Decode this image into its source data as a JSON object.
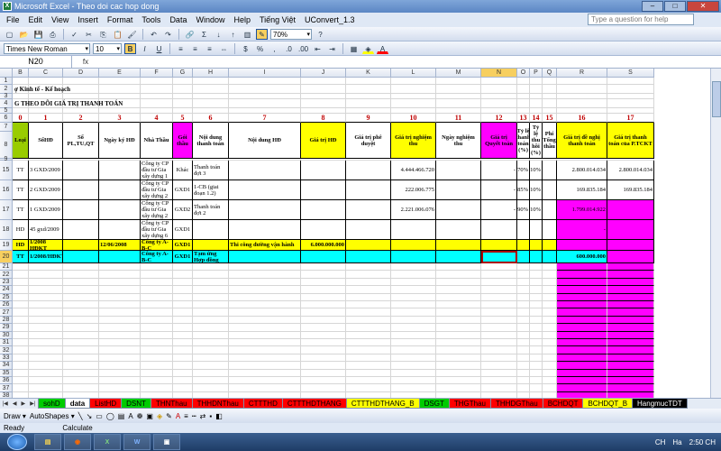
{
  "window": {
    "title": "Microsoft Excel - Theo doi cac hop dong"
  },
  "menu": [
    "File",
    "Edit",
    "View",
    "Insert",
    "Format",
    "Tools",
    "Data",
    "Window",
    "Help",
    "Tiếng Việt",
    "UConvert_1.3"
  ],
  "help_placeholder": "Type a question for help",
  "toolbar": {
    "zoom": "70%",
    "font": "Times New Roman",
    "size": "10"
  },
  "namebox": "N20",
  "columns": [
    "A",
    "B",
    "C",
    "D",
    "E",
    "F",
    "G",
    "H",
    "I",
    "J",
    "K",
    "L",
    "M",
    "N",
    "O",
    "P",
    "Q",
    "R",
    "S"
  ],
  "selected_col": "N",
  "rows": [
    "1",
    "2",
    "3",
    "4",
    "5",
    "6",
    "7",
    "8",
    "9",
    "15",
    "16",
    "17",
    "18",
    "19",
    "20",
    "21",
    "22",
    "23",
    "24",
    "25",
    "26",
    "27",
    "28",
    "29",
    "30",
    "31",
    "32",
    "33",
    "34",
    "35",
    "36",
    "37",
    "38",
    "39"
  ],
  "selected_row": "20",
  "title_text": {
    "r2": "ợ Kinh tế - Kế hoạch",
    "r4": "G THEO DÕI GIÁ TRỊ THANH TOÁN"
  },
  "colnums": [
    "0",
    "1",
    "2",
    "3",
    "4",
    "5",
    "6",
    "7",
    "8",
    "9",
    "10",
    "11",
    "12",
    "13",
    "14",
    "15",
    "16",
    "17"
  ],
  "headers": [
    "Loại",
    "SốHĐ",
    "Số PL,TU,QT",
    "Ngày ký HĐ",
    "Nhà Thầu",
    "Gói thầu",
    "Nội dung thanh toán",
    "Nội dung HĐ",
    "Giá trị HĐ",
    "Giá trị phê duyệt",
    "Giá trị nghiệm thu",
    "Ngày nghiệm thu",
    "Giá trị Quyết toán",
    "Tỷ lệ thanh toán (%)",
    "Tỷ lệ thu hồi (%)",
    "Phí Tổng thầu",
    "Giá trị đề nghị thanh toán",
    "Giá trị thanh toán của P.TCKT"
  ],
  "data_rows": [
    {
      "row": "15",
      "cells": [
        "TT",
        "3 GXD/2009",
        "",
        "",
        "Công ty CP đầu tư Gia xây dựng 1",
        "Khác",
        "Thanh toán đợt 3",
        "",
        "",
        "",
        "4.444.466.720",
        "",
        "-",
        "70%",
        "10%",
        "",
        "2.800.014.034",
        "2.800.014.034"
      ]
    },
    {
      "row": "16",
      "cells": [
        "TT",
        "2 GXD/2009",
        "",
        "",
        "Công ty CP đầu tư Gia xây dựng 2",
        "GXD1",
        "1-CB (giai đoạn 1.2)",
        "",
        "",
        "",
        "222.006.775",
        "",
        "-",
        "85%",
        "10%",
        "",
        "169.835.184",
        "169.835.184"
      ]
    },
    {
      "row": "17",
      "cells": [
        "TT",
        "1 GXD/2009",
        "",
        "",
        "Công ty CP đầu tư Gia xây dựng 2",
        "GXD2",
        "Thanh toán đợt 2",
        "",
        "",
        "",
        "2.221.006.076",
        "",
        "-",
        "90%",
        "10%",
        "",
        "1.799.014.922",
        ""
      ]
    },
    {
      "row": "18",
      "cells": [
        "HD",
        "45 gxd/2009",
        "",
        "",
        "Công ty CP đầu tư Gia xây dựng 6",
        "GXD1",
        "",
        "",
        "",
        "",
        "",
        "",
        "",
        "",
        "",
        "",
        "-",
        ""
      ]
    },
    {
      "row": "19",
      "cells": [
        "HD",
        "1/2008 HĐKT",
        "",
        "12/06/2008",
        "Công ty A-B-C",
        "GXD1",
        "",
        "Thi công đường vận hành",
        "6.000.000.000",
        "",
        "",
        "",
        "",
        "",
        "",
        "",
        "",
        ""
      ]
    },
    {
      "row": "20",
      "cells": [
        "TT",
        "1/2008/HĐKT",
        "",
        "",
        "Công ty A-B-C",
        "GXD1",
        "Tạm ứng Hợp đồng",
        "",
        "",
        "",
        "",
        "",
        "",
        "",
        "",
        "",
        "600.000.000",
        ""
      ]
    }
  ],
  "sheets": [
    "sohD",
    "data",
    "ListHD",
    "DSNT",
    "THNThau",
    "THHDNThau",
    "CTTTHD",
    "CTTTHDTHANG",
    "CTTTHDTHANG_B",
    "DSGT",
    "THGThau",
    "THHDGThau",
    "BCHDQT",
    "BCHDQT_B",
    "HangmucTDT"
  ],
  "active_sheet": "data",
  "drawbar": {
    "draw": "Draw ▾",
    "autoshapes": "AutoShapes ▾"
  },
  "status": {
    "ready": "Ready",
    "calc": "Calculate"
  },
  "tray": {
    "lang": "CH",
    "ime": "Ha",
    "time": "2:50 CH"
  },
  "colors": {
    "green": "#99cc00",
    "yellow": "#ffff00",
    "magenta": "#ff00ff",
    "cyan": "#00ffff"
  }
}
